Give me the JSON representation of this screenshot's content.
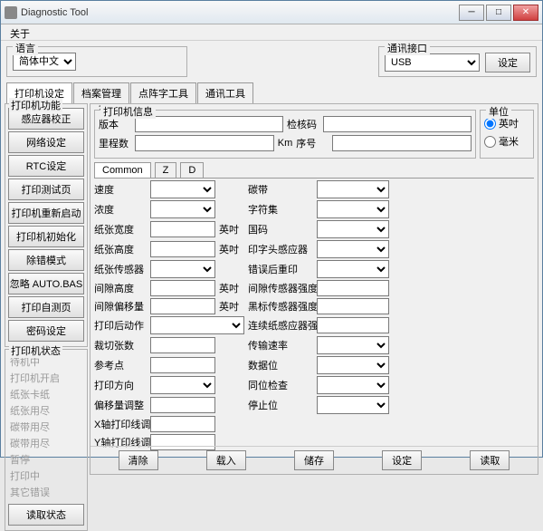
{
  "window": {
    "title": "Diagnostic Tool"
  },
  "menu": {
    "about": "关于"
  },
  "lang": {
    "label": "语言",
    "value": "简体中文"
  },
  "comm": {
    "label": "通讯接口",
    "value": "USB",
    "set": "设定"
  },
  "tabs": {
    "t1": "打印机设定",
    "t2": "档案管理",
    "t3": "点阵字工具",
    "t4": "通讯工具"
  },
  "funcs": {
    "label": "打印机功能",
    "b1": "感应器校正",
    "b2": "网络设定",
    "b3": "RTC设定",
    "b4": "打印测试页",
    "b5": "打印机重新启动",
    "b6": "打印机初始化",
    "b7": "除错模式",
    "b8": "忽略 AUTO.BAS",
    "b9": "打印自测页",
    "b10": "密码设定"
  },
  "status": {
    "label": "打印机状态",
    "s1": "待机中",
    "s2": "打印机开启",
    "s3": "纸张卡纸",
    "s4": "纸张用尽",
    "s5": "碳带用尽",
    "s6": "碳带用尽",
    "s7": "暂停",
    "s8": "打印中",
    "s9": "其它错误",
    "read": "读取状态"
  },
  "config": {
    "label": "打印机设定",
    "info": {
      "label": "打印机信息",
      "ver": "版本",
      "chk": "检核码",
      "mile": "里程数",
      "km": "Km",
      "ser": "序号"
    },
    "unit": {
      "label": "单位",
      "inch": "英吋",
      "mm": "毫米"
    },
    "subtabs": {
      "common": "Common",
      "z": "Z",
      "d": "D"
    },
    "fields": {
      "speed": "速度",
      "ribbon": "碳带",
      "density": "浓度",
      "charset": "字符集",
      "pwidth": "纸张宽度",
      "inch1": "英吋",
      "country": "国码",
      "pheight": "纸张高度",
      "inch2": "英吋",
      "headsensor": "印字头感应器",
      "psensor": "纸张传感器",
      "reprint": "错误后重印",
      "gapheight": "间隙高度",
      "inch3": "英吋",
      "gapsensor": "间隙传感器强度",
      "gapoffset": "间隙偏移量",
      "inch4": "英吋",
      "bmsensor": "黑标传感器强度",
      "postprint": "打印后动作",
      "contsensor": "连续纸感应器强度",
      "cutcount": "裁切张数",
      "baud": "传输速率",
      "refpoint": "参考点",
      "databits": "数据位",
      "printdir": "打印方向",
      "parity": "同位检查",
      "offsetadj": "偏移量调整",
      "stopbit": "停止位",
      "xadj": "X轴打印线调整",
      "yadj": "Y轴打印线调整"
    },
    "buttons": {
      "clear": "清除",
      "load": "载入",
      "save": "储存",
      "set": "设定",
      "read": "读取"
    }
  }
}
